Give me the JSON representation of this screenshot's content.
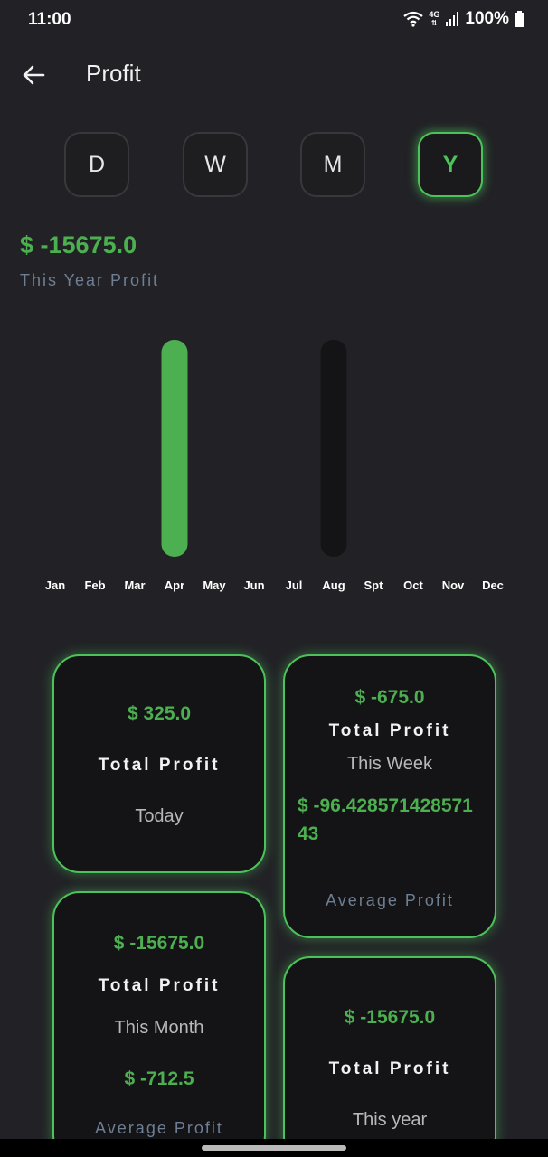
{
  "status_bar": {
    "time": "11:00",
    "network": "4G",
    "battery": "100%"
  },
  "header": {
    "title": "Profit"
  },
  "periods": [
    {
      "label": "D",
      "active": false
    },
    {
      "label": "W",
      "active": false
    },
    {
      "label": "M",
      "active": false
    },
    {
      "label": "Y",
      "active": true
    }
  ],
  "summary": {
    "value": "$ -15675.0",
    "label": "This Year Profit"
  },
  "chart_data": {
    "type": "bar",
    "categories": [
      "Jan",
      "Feb",
      "Mar",
      "Apr",
      "May",
      "Jun",
      "Jul",
      "Aug",
      "Spt",
      "Oct",
      "Nov",
      "Dec"
    ],
    "values": [
      0,
      0,
      0,
      1,
      0,
      0,
      0,
      -1,
      0,
      0,
      0,
      0
    ],
    "colors": {
      "positive": "#4caf50",
      "negative": "#141416"
    },
    "title": "",
    "xlabel": "",
    "ylabel": "",
    "grid": false
  },
  "cards": {
    "today": {
      "value": "$ 325.0",
      "title": "Total Profit",
      "period": "Today"
    },
    "week": {
      "value": "$ -675.0",
      "title": "Total Profit",
      "period": "This Week",
      "average_value": "$ -96.42857142857143",
      "average_label": "Average Profit"
    },
    "month": {
      "value": "$ -15675.0",
      "title": "Total Profit",
      "period": "This Month",
      "average_value": "$ -712.5",
      "average_label": "Average Profit"
    },
    "year": {
      "value": "$ -15675.0",
      "title": "Total Profit",
      "period": "This year"
    }
  },
  "colors": {
    "accent": "#4cc25a",
    "value_green": "#4caf50",
    "background": "#222226",
    "card_bg": "#141416",
    "muted_label": "#6e7f94"
  }
}
